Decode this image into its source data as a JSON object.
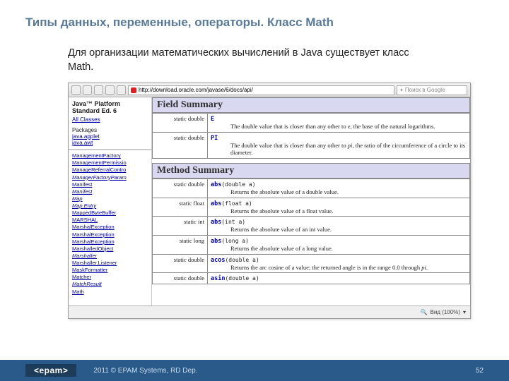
{
  "title": "Типы данных, переменные, операторы. Класс Math",
  "body_text": "Для организации математических вычислений в Java существует класс Math.",
  "browser": {
    "url": "http://download.oracle.com/javase/6/docs/api/",
    "search_placeholder": "Поиск в Google",
    "zoom": "Вид (100%)"
  },
  "left": {
    "platform": "Java™ Platform\nStandard Ed. 6",
    "all_classes": "All Classes",
    "packages_label": "Packages",
    "packages": [
      "java.applet",
      "java.awt"
    ],
    "classes": [
      {
        "t": "ManagementFactory",
        "n": true
      },
      {
        "t": "ManagementPermissio",
        "n": true
      },
      {
        "t": "ManageReferralContro",
        "n": true
      },
      {
        "t": "ManagerFactoryParam",
        "n": false
      },
      {
        "t": "Manifest",
        "n": true
      },
      {
        "t": "Manifest",
        "n": false
      },
      {
        "t": "Map",
        "n": false
      },
      {
        "t": "Map.Entry",
        "n": false
      },
      {
        "t": "MappedByteBuffer",
        "n": true
      },
      {
        "t": "MARSHAL",
        "n": true
      },
      {
        "t": "MarshalException",
        "n": true
      },
      {
        "t": "MarshalException",
        "n": true
      },
      {
        "t": "MarshalException",
        "n": true
      },
      {
        "t": "MarshalledObject",
        "n": true
      },
      {
        "t": "Marshaller",
        "n": false
      },
      {
        "t": "Marshaller.Listener",
        "n": true
      },
      {
        "t": "MaskFormatter",
        "n": true
      },
      {
        "t": "Matcher",
        "n": true
      },
      {
        "t": "MatchResult",
        "n": false
      },
      {
        "t": "Math",
        "n": true
      }
    ]
  },
  "field_summary": {
    "header": "Field Summary",
    "rows": [
      {
        "sig": "static double",
        "name": "E",
        "desc_pre": "The double value that is closer than any other to ",
        "desc_it": "e",
        "desc_post": ", the base of the natural logarithms."
      },
      {
        "sig": "static double",
        "name": "PI",
        "desc_pre": "The double value that is closer than any other to ",
        "desc_it": "pi",
        "desc_post": ", the ratio of the circumference of a circle to its diameter."
      }
    ]
  },
  "method_summary": {
    "header": "Method Summary",
    "rows": [
      {
        "sig": "static double",
        "name": "abs",
        "args": "(double a)",
        "desc": "Returns the absolute value of a double value."
      },
      {
        "sig": "static float",
        "name": "abs",
        "args": "(float a)",
        "desc": "Returns the absolute value of a float value."
      },
      {
        "sig": "static int",
        "name": "abs",
        "args": "(int a)",
        "desc": "Returns the absolute value of an int value."
      },
      {
        "sig": "static long",
        "name": "abs",
        "args": "(long a)",
        "desc": "Returns the absolute value of a long value."
      },
      {
        "sig": "static double",
        "name": "acos",
        "args": "(double a)",
        "desc_pre": "Returns the arc cosine of a value; the returned angle is in the range 0.0 through ",
        "desc_it": "pi",
        "desc_post": "."
      },
      {
        "sig": "static double",
        "name": "asin",
        "args": "(double a)",
        "desc": ""
      }
    ]
  },
  "footer": {
    "logo": "<epam>",
    "copyright": "2011 © EPAM Systems, RD Dep.",
    "page": "52"
  }
}
